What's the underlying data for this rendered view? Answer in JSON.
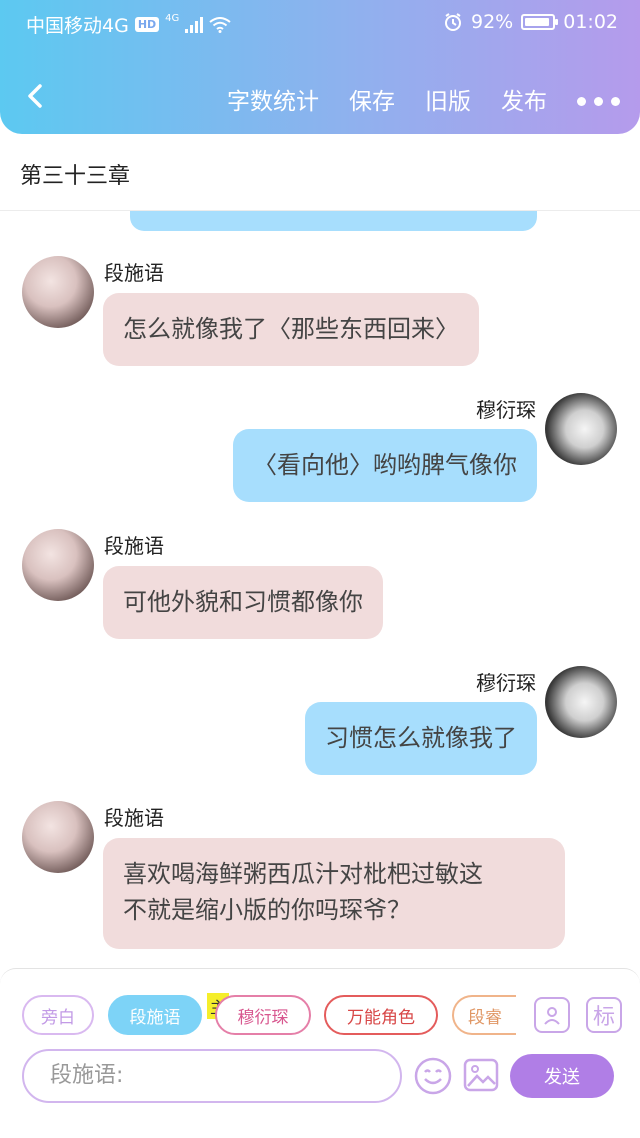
{
  "status_bar": {
    "carrier": "中国移动4G",
    "hd": "HD",
    "network": "4G",
    "battery": "92%",
    "time": "01:02"
  },
  "nav": {
    "actions": [
      "字数统计",
      "保存",
      "旧版",
      "发布"
    ]
  },
  "chapter_title": "第三十三章",
  "messages": [
    {
      "sender": "段施语",
      "side": "left",
      "text": "怎么就像我了〈那些东西回来〉"
    },
    {
      "sender": "穆衍琛",
      "side": "right",
      "text": "〈看向他〉哟哟脾气像你"
    },
    {
      "sender": "段施语",
      "side": "left",
      "text": "可他外貌和习惯都像你"
    },
    {
      "sender": "穆衍琛",
      "side": "right",
      "text": "习惯怎么就像我了"
    },
    {
      "sender": "段施语",
      "side": "left",
      "text_line1": "喜欢喝海鲜粥西瓜汁对枇杷过敏这",
      "text_line2": "不就是缩小版的你吗琛爷？"
    }
  ],
  "roles": {
    "chips": [
      "旁白",
      "段施语",
      "穆衍琛",
      "万能角色",
      "段睿"
    ],
    "main_tag": "主",
    "tag_button": "标"
  },
  "input": {
    "placeholder": "段施语:",
    "send_label": "发送"
  },
  "colors": {
    "header_start": "#5cc9f1",
    "header_end": "#b59bec",
    "bubble_left": "#f1dcdc",
    "bubble_right": "#a7defd",
    "send": "#b07ee6"
  }
}
